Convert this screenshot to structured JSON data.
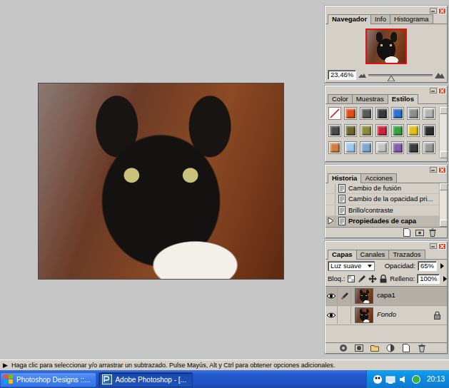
{
  "navigator": {
    "tabs": [
      {
        "label": "Navegador",
        "selected": true
      },
      {
        "label": "Info",
        "selected": false
      },
      {
        "label": "Histograma",
        "selected": false
      }
    ],
    "zoom": "23,46%",
    "zoom_level": 0.35
  },
  "styles": {
    "tabs": [
      {
        "label": "Color",
        "selected": false
      },
      {
        "label": "Muestras",
        "selected": false
      },
      {
        "label": "Estilos",
        "selected": true
      }
    ],
    "swatches": [
      {
        "kind": "none",
        "color": "#ffffff"
      },
      {
        "kind": "style",
        "color": "#e0501a"
      },
      {
        "kind": "style",
        "color": "#5a5a5a"
      },
      {
        "kind": "style",
        "color": "#3a3a3a"
      },
      {
        "kind": "style",
        "color": "#2f6fc8"
      },
      {
        "kind": "style",
        "color": "#8e8e8e"
      },
      {
        "kind": "style",
        "color": "#b4b4b4"
      },
      {
        "kind": "style",
        "color": "#4a4a4a"
      },
      {
        "kind": "style",
        "color": "#6a6a30"
      },
      {
        "kind": "style",
        "color": "#8a8a40"
      },
      {
        "kind": "style",
        "color": "#c8283c"
      },
      {
        "kind": "style",
        "color": "#3aa040"
      },
      {
        "kind": "style",
        "color": "#e0c020"
      },
      {
        "kind": "style",
        "color": "#2e2e2e"
      },
      {
        "kind": "style",
        "color": "#d08040"
      },
      {
        "kind": "style",
        "color": "#a0c8e8"
      },
      {
        "kind": "style",
        "color": "#7fa6cc"
      },
      {
        "kind": "style",
        "color": "#c4c4c4"
      },
      {
        "kind": "style",
        "color": "#8060a8"
      },
      {
        "kind": "style",
        "color": "#3c3c3c"
      },
      {
        "kind": "style",
        "color": "#9a9a9a"
      }
    ]
  },
  "history": {
    "tabs": [
      {
        "label": "Historia",
        "selected": true
      },
      {
        "label": "Acciones",
        "selected": false
      }
    ],
    "items": [
      {
        "label": "Cambio de fusión",
        "selected": false
      },
      {
        "label": "Cambio de la opacidad pri...",
        "selected": false
      },
      {
        "label": "Brillo/contraste",
        "selected": false
      },
      {
        "label": "Propiedades de capa",
        "selected": true
      }
    ]
  },
  "layers_panel": {
    "tabs": [
      {
        "label": "Capas",
        "selected": true
      },
      {
        "label": "Canales",
        "selected": false
      },
      {
        "label": "Trazados",
        "selected": false
      }
    ],
    "blend_mode": "Luz suave",
    "opacity_label": "Opacidad:",
    "opacity": "65%",
    "lock_label": "Bloq.:",
    "locks": [
      {
        "kind": "transparency",
        "on": false
      },
      {
        "kind": "paint",
        "on": false
      },
      {
        "kind": "move",
        "on": false
      },
      {
        "kind": "all",
        "on": false
      }
    ],
    "fill_label": "Relleno:",
    "fill": "100%",
    "layers": [
      {
        "name": "capa1",
        "selected": true,
        "visible": true,
        "kind": "layer",
        "locked": false
      },
      {
        "name": "Fondo",
        "selected": false,
        "visible": true,
        "kind": "background",
        "locked": true
      }
    ]
  },
  "status_bar": {
    "icon": "▶",
    "text": "Haga clic para seleccionar y/o arrastrar un subtrazado. Pulse Mayús, Alt y Ctrl para obtener opciones adicionales."
  },
  "taskbar": {
    "buttons": [
      {
        "label": "Photoshop Designs ::...",
        "selected": false
      },
      {
        "label": "Adobe Photoshop - [...",
        "selected": true
      }
    ],
    "clock": "20:13"
  }
}
